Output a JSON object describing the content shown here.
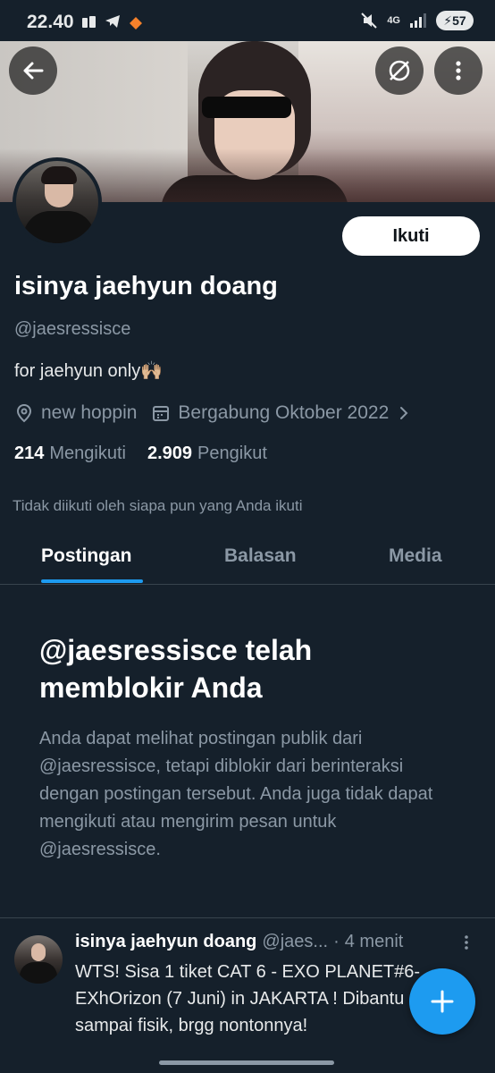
{
  "status_bar": {
    "time": "22.40",
    "network": "4G",
    "battery": "57"
  },
  "profile": {
    "follow_label": "Ikuti",
    "display_name": "isinya jaehyun doang",
    "handle": "@jaesressisce",
    "bio": "for jaehyun only🙌🏼",
    "location": "new hoppin",
    "joined": "Bergabung Oktober 2022",
    "following_count": "214",
    "following_label": "Mengikuti",
    "followers_count": "2.909",
    "followers_label": "Pengikut",
    "not_followed_note": "Tidak diikuti oleh siapa pun yang Anda ikuti"
  },
  "tabs": [
    {
      "label": "Postingan",
      "active": true
    },
    {
      "label": "Balasan",
      "active": false
    },
    {
      "label": "Media",
      "active": false
    }
  ],
  "blocked": {
    "title": "@jaesressisce telah memblokir Anda",
    "description": "Anda dapat melihat postingan publik dari @jaesressisce, tetapi diblokir dari berinteraksi dengan postingan tersebut. Anda juga tidak dapat mengikuti atau mengirim pesan untuk @jaesressisce."
  },
  "post": {
    "name": "isinya jaehyun doang",
    "handle": "@jaes...",
    "time": "4 menit",
    "text": "WTS! Sisa 1 tiket CAT 6 - EXO PLANET#6-EXhOrizon (7 Juni) in JAKARTA ! Dibantu sampai fisik, brgg nontonnya!"
  },
  "icons": {
    "back": "arrow-left-icon",
    "mute": "muted-circle-icon",
    "more": "more-vertical-icon",
    "location": "location-pin-icon",
    "calendar": "calendar-icon",
    "chevron": "chevron-right-icon",
    "compose": "plus-icon"
  },
  "colors": {
    "background": "#15202b",
    "accent": "#1d9bf0",
    "secondary_text": "#8b98a5"
  }
}
